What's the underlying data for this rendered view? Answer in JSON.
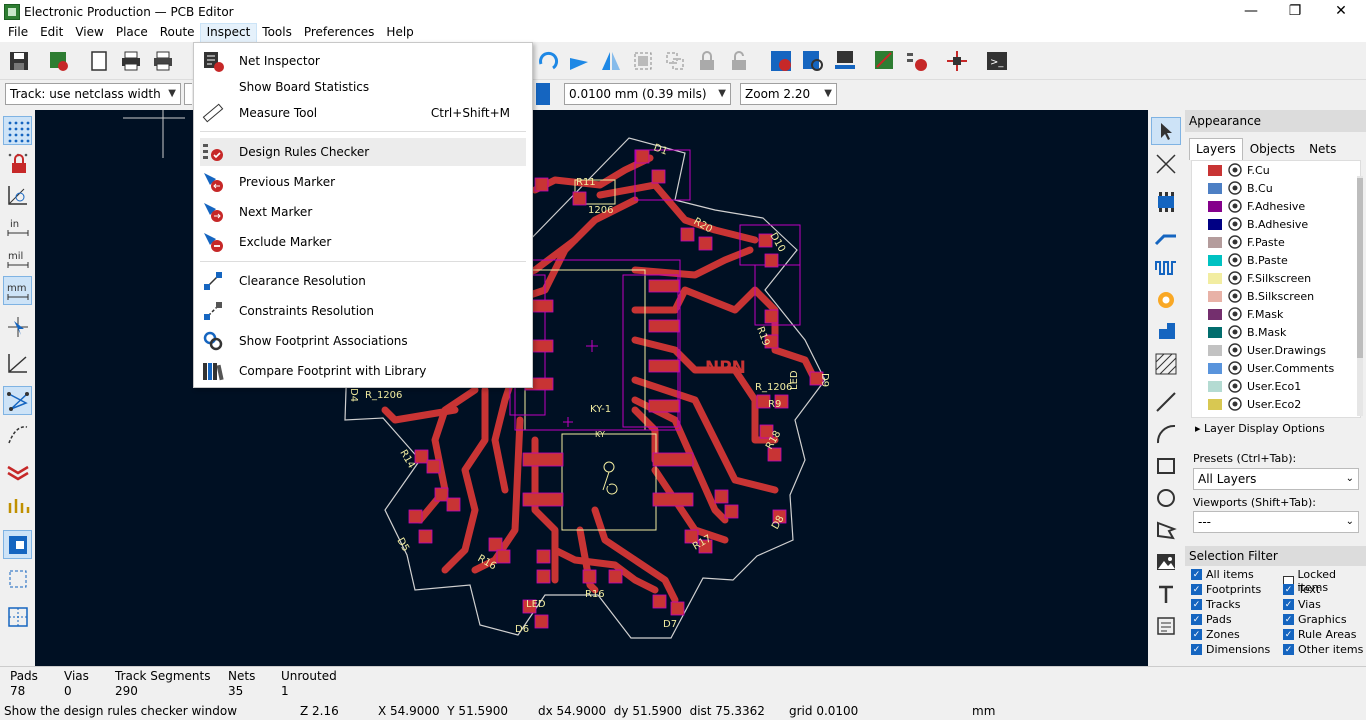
{
  "window": {
    "title": "Electronic Production — PCB Editor",
    "minimize": "—",
    "maximize": "❐",
    "close": "✕"
  },
  "menu": [
    {
      "label": "File"
    },
    {
      "label": "Edit"
    },
    {
      "label": "View"
    },
    {
      "label": "Place"
    },
    {
      "label": "Route"
    },
    {
      "label": "Inspect"
    },
    {
      "label": "Tools"
    },
    {
      "label": "Preferences"
    },
    {
      "label": "Help"
    }
  ],
  "aux": {
    "track": "Track: use netclass width",
    "grid": "0.0100 mm (0.39 mils)",
    "zoom": "Zoom 2.20"
  },
  "inspect_menu": {
    "items": [
      {
        "label": "Net Inspector",
        "shortcut": "",
        "icon": "net-inspector-icon"
      },
      {
        "label": "Show Board Statistics",
        "shortcut": "",
        "icon": ""
      },
      {
        "label": "Measure Tool",
        "shortcut": "Ctrl+Shift+M",
        "icon": "measure-icon"
      },
      {
        "label": "Design Rules Checker",
        "shortcut": "",
        "icon": "drc-icon"
      },
      {
        "label": "Previous Marker",
        "shortcut": "",
        "icon": "previous-marker-icon"
      },
      {
        "label": "Next Marker",
        "shortcut": "",
        "icon": "next-marker-icon"
      },
      {
        "label": "Exclude Marker",
        "shortcut": "",
        "icon": "exclude-marker-icon"
      },
      {
        "label": "Clearance Resolution",
        "shortcut": "",
        "icon": "clearance-icon"
      },
      {
        "label": "Constraints Resolution",
        "shortcut": "",
        "icon": "constraints-icon"
      },
      {
        "label": "Show Footprint Associations",
        "shortcut": "",
        "icon": "footprint-assoc-icon"
      },
      {
        "label": "Compare Footprint with Library",
        "shortcut": "",
        "icon": "compare-library-icon"
      }
    ]
  },
  "left_toolbar": {
    "units_in": "in",
    "units_mil": "mil",
    "units_mm": "mm"
  },
  "appearance": {
    "title": "Appearance",
    "tabs": [
      "Layers",
      "Objects",
      "Nets"
    ],
    "layers": [
      {
        "name": "F.Cu",
        "color": "#c83434"
      },
      {
        "name": "B.Cu",
        "color": "#4d7fc4"
      },
      {
        "name": "F.Adhesive",
        "color": "#84008b"
      },
      {
        "name": "B.Adhesive",
        "color": "#000084"
      },
      {
        "name": "F.Paste",
        "color": "#b49c9c"
      },
      {
        "name": "B.Paste",
        "color": "#00c2c2"
      },
      {
        "name": "F.Silkscreen",
        "color": "#f2eda1"
      },
      {
        "name": "B.Silkscreen",
        "color": "#e8b2a7"
      },
      {
        "name": "F.Mask",
        "color": "#742f6e"
      },
      {
        "name": "B.Mask",
        "color": "#026d6d"
      },
      {
        "name": "User.Drawings",
        "color": "#c2c2c2"
      },
      {
        "name": "User.Comments",
        "color": "#5994dc"
      },
      {
        "name": "User.Eco1",
        "color": "#b4dbd2"
      },
      {
        "name": "User.Eco2",
        "color": "#d8c852"
      }
    ],
    "layer_display_options": "Layer Display Options",
    "presets_label": "Presets (Ctrl+Tab):",
    "presets_value": "All Layers",
    "viewports_label": "Viewports (Shift+Tab):",
    "viewports_value": "---"
  },
  "selection_filter": {
    "title": "Selection Filter",
    "items": [
      {
        "label": "All items",
        "checked": true
      },
      {
        "label": "Locked items",
        "checked": false
      },
      {
        "label": "Footprints",
        "checked": true
      },
      {
        "label": "Text",
        "checked": true
      },
      {
        "label": "Tracks",
        "checked": true
      },
      {
        "label": "Vias",
        "checked": true
      },
      {
        "label": "Pads",
        "checked": true
      },
      {
        "label": "Graphics",
        "checked": true
      },
      {
        "label": "Zones",
        "checked": true
      },
      {
        "label": "Rule Areas",
        "checked": true
      },
      {
        "label": "Dimensions",
        "checked": true
      },
      {
        "label": "Other items",
        "checked": true
      }
    ]
  },
  "board_stats": [
    {
      "label": "Pads",
      "value": "78"
    },
    {
      "label": "Vias",
      "value": "0"
    },
    {
      "label": "Track Segments",
      "value": "290"
    },
    {
      "label": "Nets",
      "value": "35"
    },
    {
      "label": "Unrouted",
      "value": "1"
    }
  ],
  "status": {
    "message": "Show the design rules checker window",
    "zoom": "Z 2.16",
    "xy": "X 54.9000  Y 51.5900",
    "delta": "dx 54.9000  dy 51.5900  dist 75.3362",
    "grid": "grid 0.0100",
    "units": "mm"
  },
  "pcb_labels": {
    "npn": "NPN",
    "ky1": "KY-1",
    "ky": "KY",
    "r11": "R11",
    "r1206": "1206",
    "r20": "R20",
    "r19": "R19",
    "r18": "R18",
    "r17": "R17",
    "r16": "R16",
    "r14": "R14",
    "r9": "R9",
    "d1": "D1",
    "d10": "D10",
    "d9": "D9",
    "d8": "D8",
    "d7": "D7",
    "d6": "D6",
    "d5": "D5",
    "d4": "D4",
    "led": "LED",
    "r_1206": "R_1206"
  },
  "colors": {
    "canvas": "#001023",
    "copper": "#c83434",
    "silk": "#f2eda1",
    "edge": "#d0d0d0",
    "courtyard": "#c000c0",
    "accent": "#1565c0"
  }
}
